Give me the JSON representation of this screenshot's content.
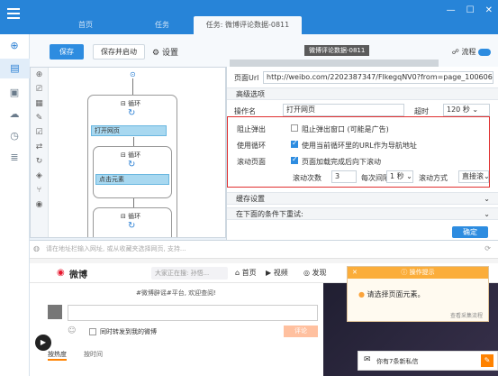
{
  "window": {
    "tabs": [
      {
        "label": "首页",
        "active": false
      },
      {
        "label": "任务",
        "active": false
      },
      {
        "label": "任务: 微博评论数据-0811",
        "active": true
      }
    ],
    "controls": {
      "minimize": "—",
      "maximize": "☐",
      "close": "✕"
    }
  },
  "toolbar": {
    "save_label": "保存",
    "save_start_label": "保存并启动",
    "settings_label": "设置",
    "tooltip_text": "微博评论数据-0811",
    "flow_label": "流程"
  },
  "flow": {
    "loop1_label": "循环",
    "step_open": "打开网页",
    "loop2_label": "循环",
    "step_click": "点击元素",
    "loop3_label": "循环"
  },
  "props": {
    "page_url_label": "页面Url",
    "page_url_value": "http://weibo.com/2202387347/FlkegqNV0?from=page_1006062202387347",
    "advanced_label": "高级选项",
    "op_name_label": "操作名",
    "op_name_value": "打开网页",
    "timeout_label": "超时",
    "timeout_value": "120 秒",
    "block_popup_label": "阻止弹出",
    "block_popup_option": "阻止弹出窗口 (可能是广告)",
    "block_popup_checked": false,
    "use_loop_label": "使用循环",
    "use_loop_option": "使用当前循环里的URL作为导航地址",
    "use_loop_checked": true,
    "scroll_label": "滚动页面",
    "scroll_option": "页面加载完成后向下滚动",
    "scroll_checked": true,
    "scroll_count_label": "滚动次数",
    "scroll_count_value": "3",
    "interval_label": "每次间隔",
    "interval_value": "1 秒",
    "scroll_mode_label": "滚动方式",
    "scroll_mode_value": "直接滚",
    "cache_label": "缓存设置",
    "retry_label": "在下面的条件下重试:",
    "confirm_label": "确定"
  },
  "browser": {
    "address_placeholder": "请在地址栏输入网址, 或从收藏夹选择网页, 支持...",
    "weibo_logo": "微博",
    "search_placeholder": "大家正在搜: 孙悟...",
    "nav_home": "首页",
    "nav_video": "视频",
    "nav_discover": "发现",
    "topic_text": "#微博辟谣#平台, 欢迎查阅!",
    "share_checkbox": "同时转发到我的微博",
    "comment_button": "评论",
    "sort_hot": "按热度",
    "sort_time": "按时间",
    "popup_title": "操作提示",
    "popup_text": "请选择页面元素。",
    "popup_link": "查看采集流程",
    "msg_text": "你有7条新私信"
  },
  "colors": {
    "titlebar": "#2784d8",
    "accent": "#2d8ce0",
    "highlight_box": "#e03030",
    "popup_header": "#fbad3a"
  }
}
